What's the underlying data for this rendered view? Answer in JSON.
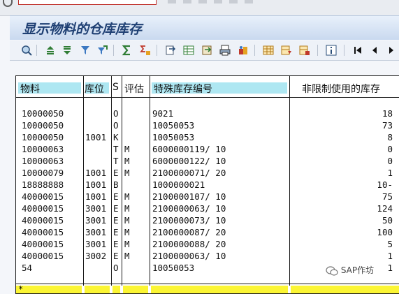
{
  "window": {
    "title": "显示物料的仓库库存"
  },
  "toolbar": {
    "icons": [
      "details-icon",
      "sort-ascending-icon",
      "sort-descending-icon",
      "filter-icon",
      "set-filter-icon",
      "sum-icon",
      "subtotal-icon",
      "export-icon",
      "spreadsheet-icon",
      "word-processing-icon",
      "print-icon",
      "abc-analysis-icon",
      "layout-icon",
      "select-layout-icon",
      "save-layout-icon",
      "info-icon",
      "first-page-icon",
      "previous-page-icon",
      "next-page-icon"
    ]
  },
  "table": {
    "headers": {
      "material": "物料",
      "storage_loc": "库位",
      "special_stock": "S",
      "valuation": "评估",
      "special_stock_no": "特殊库存编号",
      "unrestricted": "非限制使用的库存"
    },
    "rows": [
      {
        "material": "10000050",
        "loc": "",
        "s": "O",
        "val": "",
        "no": "9021",
        "qty": "18"
      },
      {
        "material": "10000050",
        "loc": "",
        "s": "O",
        "val": "",
        "no": "10050053",
        "qty": "73"
      },
      {
        "material": "10000050",
        "loc": "1001",
        "s": "K",
        "val": "",
        "no": "10050053",
        "qty": "8"
      },
      {
        "material": "10000063",
        "loc": "",
        "s": "T",
        "val": "M",
        "no": "6000000119/ 10",
        "qty": "0"
      },
      {
        "material": "10000063",
        "loc": "",
        "s": "T",
        "val": "M",
        "no": "6000000122/ 10",
        "qty": "0"
      },
      {
        "material": "10000079",
        "loc": "1001",
        "s": "E",
        "val": "M",
        "no": "2100000071/ 20",
        "qty": "1"
      },
      {
        "material": "18888888",
        "loc": "1001",
        "s": "B",
        "val": "",
        "no": "1000000021",
        "qty": "10-"
      },
      {
        "material": "40000015",
        "loc": "1001",
        "s": "E",
        "val": "M",
        "no": "2100000107/ 10",
        "qty": "75"
      },
      {
        "material": "40000015",
        "loc": "3001",
        "s": "E",
        "val": "M",
        "no": "2100000063/ 10",
        "qty": "124"
      },
      {
        "material": "40000015",
        "loc": "3001",
        "s": "E",
        "val": "M",
        "no": "2100000073/ 10",
        "qty": "50"
      },
      {
        "material": "40000015",
        "loc": "3001",
        "s": "E",
        "val": "M",
        "no": "2100000087/ 20",
        "qty": "100"
      },
      {
        "material": "40000015",
        "loc": "3001",
        "s": "E",
        "val": "M",
        "no": "2100000088/ 20",
        "qty": "5"
      },
      {
        "material": "40000015",
        "loc": "3002",
        "s": "E",
        "val": "M",
        "no": "2100000063/ 10",
        "qty": "1"
      },
      {
        "material": "54",
        "loc": "",
        "s": "O",
        "val": "",
        "no": "10050053",
        "qty": "1"
      }
    ],
    "total_marker": "*"
  },
  "watermark": {
    "text": "SAP作坊"
  },
  "colors": {
    "header_cyan": "#aee7f2",
    "total_yellow": "#fbf533",
    "title_text": "#1e3f73"
  }
}
